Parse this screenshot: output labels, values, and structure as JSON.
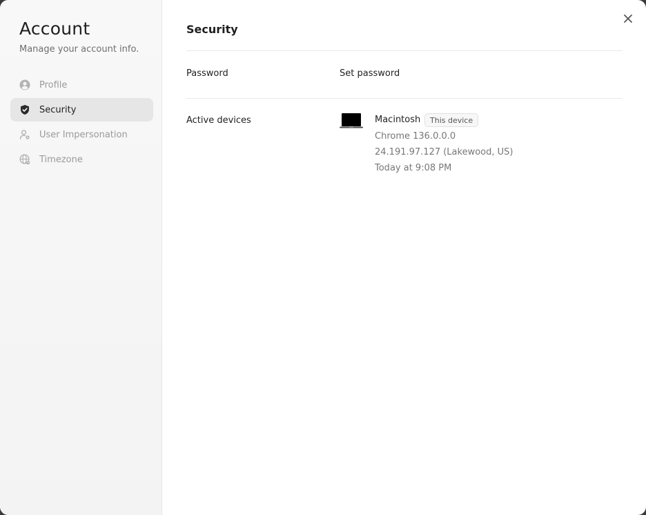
{
  "sidebar": {
    "title": "Account",
    "subtitle": "Manage your account info.",
    "items": [
      {
        "label": "Profile",
        "icon": "user-circle-icon",
        "active": false
      },
      {
        "label": "Security",
        "icon": "shield-icon",
        "active": true
      },
      {
        "label": "User Impersonation",
        "icon": "user-cog-icon",
        "active": false
      },
      {
        "label": "Timezone",
        "icon": "globe-icon",
        "active": false
      }
    ]
  },
  "main": {
    "title": "Security",
    "close_icon": "close-icon",
    "password": {
      "label": "Password",
      "action": "Set password"
    },
    "active_devices": {
      "label": "Active devices",
      "device": {
        "icon": "laptop-icon",
        "name": "Macintosh",
        "badge": "This device",
        "browser": "Chrome 136.0.0.0",
        "ip_location": "24.191.97.127 (Lakewood, US)",
        "last_active": "Today at 9:08 PM"
      }
    }
  },
  "colors": {
    "sidebar_bg": "#f5f5f5",
    "active_item_bg": "#e6e6e6",
    "text_primary": "#1f1f1f",
    "text_muted": "#9a9a9a"
  }
}
